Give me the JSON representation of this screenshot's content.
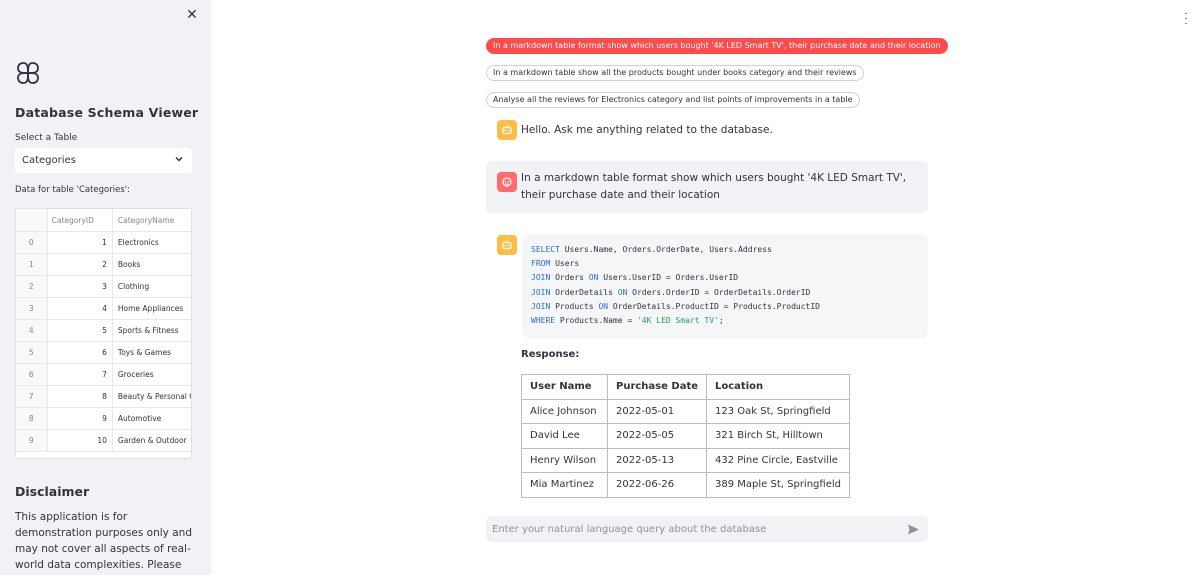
{
  "sidebar": {
    "close_icon": "close-icon",
    "logo_icon": "flower-logo-icon",
    "title": "Database Schema Viewer",
    "select_label": "Select a Table",
    "selected_table": "Categories",
    "data_label": "Data for table 'Categories':",
    "columns": [
      "",
      "CategoryID",
      "CategoryName"
    ],
    "rows": [
      {
        "idx": "0",
        "id": "1",
        "name": "Electronics"
      },
      {
        "idx": "1",
        "id": "2",
        "name": "Books"
      },
      {
        "idx": "2",
        "id": "3",
        "name": "Clothing"
      },
      {
        "idx": "3",
        "id": "4",
        "name": "Home Appliances"
      },
      {
        "idx": "4",
        "id": "5",
        "name": "Sports & Fitness"
      },
      {
        "idx": "5",
        "id": "6",
        "name": "Toys & Games"
      },
      {
        "idx": "6",
        "id": "7",
        "name": "Groceries"
      },
      {
        "idx": "7",
        "id": "8",
        "name": "Beauty & Personal Care"
      },
      {
        "idx": "8",
        "id": "9",
        "name": "Automotive"
      },
      {
        "idx": "9",
        "id": "10",
        "name": "Garden & Outdoor"
      }
    ],
    "disclaimer_title": "Disclaimer",
    "disclaimer_text": "This application is for demonstration purposes only and may not cover all aspects of real-world data complexities. Please use"
  },
  "suggestions": [
    "In a markdown table format show which users bought '4K LED Smart TV', their purchase date and their location",
    "In a markdown table show all the products bought under books category and their reviews",
    "Analyse all the reviews for Electronics category and list points of improvements in a table"
  ],
  "chat": {
    "greeting": "Hello. Ask me anything related to the database.",
    "user_query": "In a markdown table format show which users bought '4K LED Smart TV', their purchase date and their location",
    "sql": {
      "line1_kw": "SELECT",
      "line1_rest": " Users.Name, Orders.OrderDate, Users.Address",
      "line2_kw": "FROM",
      "line2_rest": " Users",
      "line3_kw": "JOIN",
      "line3_mid": " Orders ",
      "line3_kw2": "ON",
      "line3_rest": " Users.UserID = Orders.UserID",
      "line4_kw": "JOIN",
      "line4_mid": " OrderDetails ",
      "line4_kw2": "ON",
      "line4_rest": " Orders.OrderID = OrderDetails.OrderID",
      "line5_kw": "JOIN",
      "line5_mid": " Products ",
      "line5_kw2": "ON",
      "line5_rest": " OrderDetails.ProductID = Products.ProductID",
      "line6_kw": "WHERE",
      "line6_mid": " Products.Name = ",
      "line6_str": "'4K LED Smart TV'",
      "line6_end": ";"
    },
    "response_label": "Response:",
    "table_headers": [
      "User Name",
      "Purchase Date",
      "Location"
    ],
    "table_rows": [
      [
        "Alice Johnson",
        "2022-05-01",
        "123 Oak St, Springfield"
      ],
      [
        "David Lee",
        "2022-05-05",
        "321 Birch St, Hilltown"
      ],
      [
        "Henry Wilson",
        "2022-05-13",
        "432 Pine Circle, Eastville"
      ],
      [
        "Mia Martinez",
        "2022-06-26",
        "389 Maple St, Springfield"
      ]
    ]
  },
  "input": {
    "placeholder": "Enter your natural language query about the database",
    "send_icon": "send-icon"
  },
  "colors": {
    "accent": "#ff4b4b",
    "bot_avatar": "#ffbd45",
    "user_avatar": "#ff6c6c",
    "sidebar_bg": "#f0f2f6",
    "sql_keyword": "#2d6dd6",
    "sql_string": "#21a650"
  }
}
